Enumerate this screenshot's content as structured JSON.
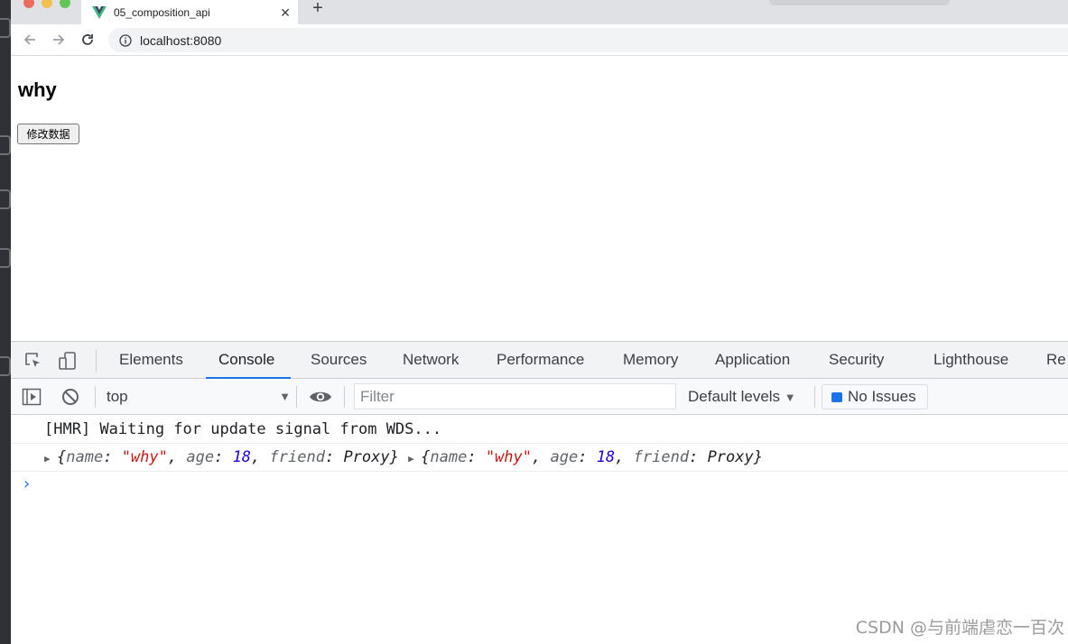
{
  "browser": {
    "tab_title": "05_composition_api",
    "tab_close": "✕",
    "new_tab": "+",
    "url": "localhost:8080"
  },
  "page": {
    "title": "why",
    "button_label": "修改数据"
  },
  "devtools": {
    "tabs": [
      {
        "label": "Elements",
        "active": false
      },
      {
        "label": "Console",
        "active": true
      },
      {
        "label": "Sources",
        "active": false
      },
      {
        "label": "Network",
        "active": false
      },
      {
        "label": "Performance",
        "active": false
      },
      {
        "label": "Memory",
        "active": false
      },
      {
        "label": "Application",
        "active": false
      },
      {
        "label": "Security",
        "active": false
      },
      {
        "label": "Lighthouse",
        "active": false
      },
      {
        "label": "Re",
        "active": false
      }
    ],
    "toolbar": {
      "context": "top",
      "filter_placeholder": "Filter",
      "levels": "Default levels",
      "issues": "No Issues"
    },
    "console": {
      "hmr_line": "[HMR] Waiting for update signal from WDS...",
      "objects": [
        {
          "name_key": "name",
          "name_val": "\"why\"",
          "age_key": "age",
          "age_val": "18",
          "friend_key": "friend",
          "friend_val": "Proxy"
        },
        {
          "name_key": "name",
          "name_val": "\"why\"",
          "age_key": "age",
          "age_val": "18",
          "friend_key": "friend",
          "friend_val": "Proxy"
        }
      ],
      "prompt": "›"
    }
  },
  "watermark": "CSDN @与前端虐恋一百次",
  "colors": {
    "accent": "#1a73e8",
    "string": "#c41a16",
    "number": "#1c00cf"
  }
}
